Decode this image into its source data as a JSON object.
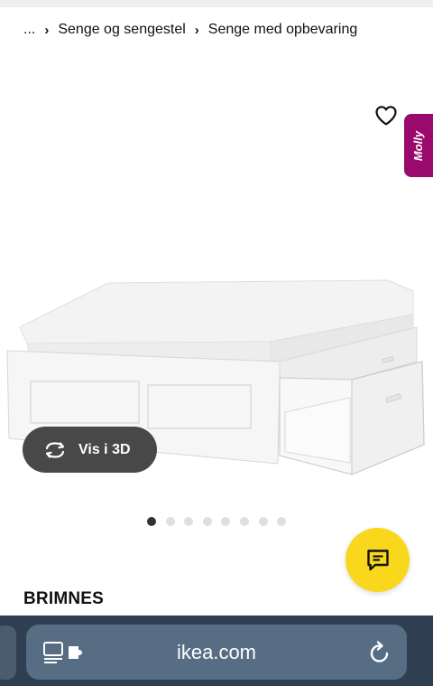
{
  "breadcrumb": {
    "ellipsis": "...",
    "separator": "›",
    "items": [
      "Senge og sengestel",
      "Senge med opbevaring"
    ]
  },
  "gallery": {
    "molly_label": "Molly",
    "view_3d_label": "Vis i 3D",
    "dot_count": 8,
    "active_dot": 1
  },
  "product": {
    "title": "BRIMNES"
  },
  "browser": {
    "url": "ikea.com"
  },
  "colors": {
    "chat_button": "#f9d71c",
    "molly_tab": "#9a0a6c",
    "browser_bar": "#2f3f51",
    "url_pill": "#566d83"
  },
  "icons": [
    "heart-icon",
    "rotate-3d-icon",
    "chat-icon",
    "reader-mode-icon",
    "reload-icon"
  ]
}
